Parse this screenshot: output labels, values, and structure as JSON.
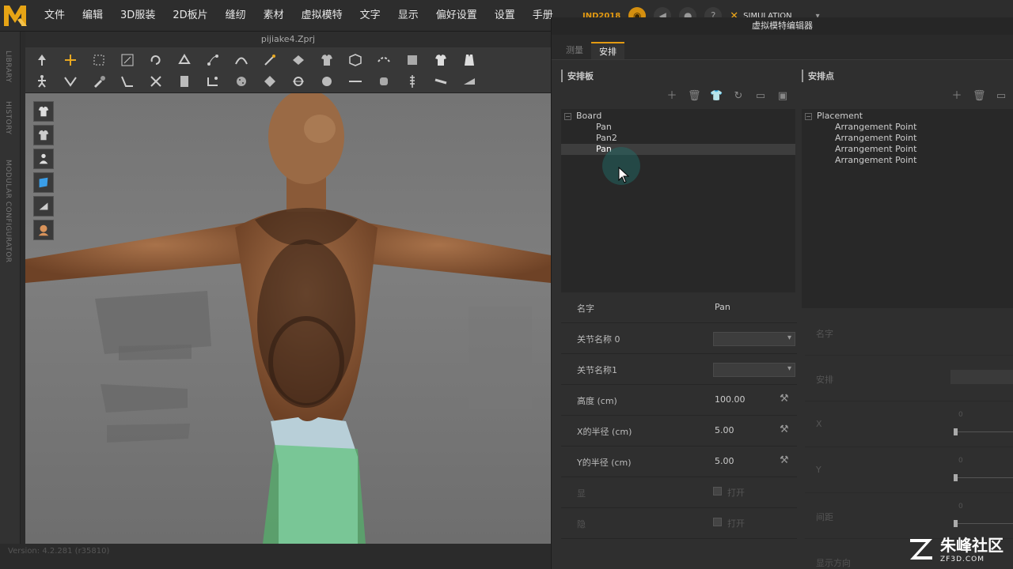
{
  "menu": [
    "文件",
    "编辑",
    "3D服装",
    "2D板片",
    "缝纫",
    "素材",
    "虚拟模特",
    "文字",
    "显示",
    "偏好设置",
    "设置",
    "手册"
  ],
  "status": {
    "product": "IND2018",
    "mode": "SIMULATION"
  },
  "side_tabs": [
    "LIBRARY",
    "HISTORY",
    "MODULAR CONFIGURATOR"
  ],
  "viewport": {
    "title": "pijiake4.Zprj"
  },
  "version": "Version: 4.2.281 (r35810)",
  "editor": {
    "title": "虚拟模特编辑器",
    "tabs": [
      "测量",
      "安排"
    ],
    "left_section": "安排板",
    "right_section": "安排点",
    "board_tree": {
      "root": "Board",
      "children": [
        "Pan",
        "Pan2",
        "Pan"
      ]
    },
    "placement_tree": {
      "root": "Placement",
      "children": [
        "Arrangement Point",
        "Arrangement Point",
        "Arrangement Point",
        "Arrangement Point"
      ]
    },
    "properties": {
      "name_label": "名字",
      "name_value": "Pan",
      "joint0_label": "关节名称 0",
      "joint1_label": "关节名称1",
      "height_label": "高度 (cm)",
      "height_value": "100.00",
      "xradius_label": "X的半径 (cm)",
      "xradius_value": "5.00",
      "yradius_label": "Y的半径 (cm)",
      "yradius_value": "5.00",
      "row7_label": "显",
      "row7_check": "打开",
      "row8_label": "隐",
      "row8_check": "打开"
    },
    "right_properties": {
      "name_label": "名字",
      "arrange_label": "安排",
      "x_label": "X",
      "x_value": "0",
      "y_label": "Y",
      "y_value": "0",
      "gap_label": "间距",
      "gap_value": "0",
      "direction_label": "显示方向"
    }
  },
  "watermark": {
    "cn": "朱峰社区",
    "url": "ZF3D.COM"
  }
}
